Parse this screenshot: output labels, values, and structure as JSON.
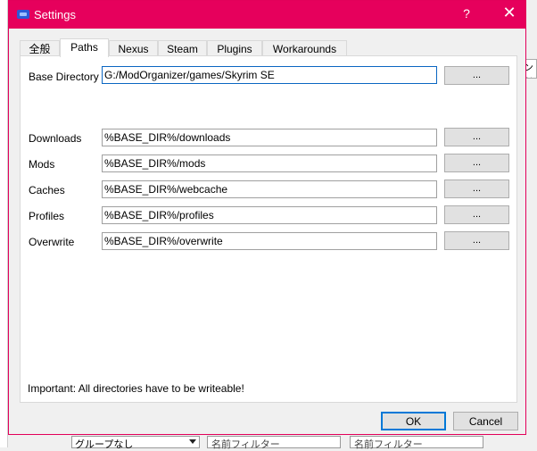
{
  "dialog": {
    "title": "Settings",
    "help_glyph": "?",
    "close_glyph": "✕"
  },
  "tabs": [
    {
      "label": "全般"
    },
    {
      "label": "Paths"
    },
    {
      "label": "Nexus"
    },
    {
      "label": "Steam"
    },
    {
      "label": "Plugins"
    },
    {
      "label": "Workarounds"
    }
  ],
  "active_tab": "Paths",
  "paths": {
    "base": {
      "label": "Base Directory",
      "value": "G:/ModOrganizer/games/Skyrim SE"
    },
    "downloads": {
      "label": "Downloads",
      "value": "%BASE_DIR%/downloads"
    },
    "mods": {
      "label": "Mods",
      "value": "%BASE_DIR%/mods"
    },
    "caches": {
      "label": "Caches",
      "value": "%BASE_DIR%/webcache"
    },
    "profiles": {
      "label": "Profiles",
      "value": "%BASE_DIR%/profiles"
    },
    "overwrite": {
      "label": "Overwrite",
      "value": "%BASE_DIR%/overwrite"
    }
  },
  "browse_label": "...",
  "note": "Important: All directories have to be writeable!",
  "buttons": {
    "ok": "OK",
    "cancel": "Cancel"
  },
  "background": {
    "group_combo": "グループなし",
    "name_filter_1": "名前フィルター",
    "name_filter_2": "名前フィルター",
    "right_fragment": "ンド"
  },
  "colors": {
    "titlebar": "#e6005c",
    "accent": "#0078d7"
  }
}
